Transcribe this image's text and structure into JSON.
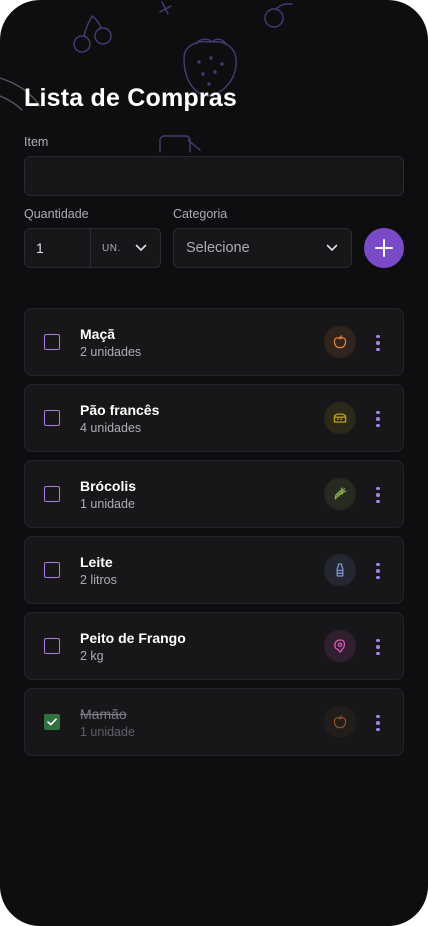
{
  "header": {
    "title": "Lista de Compras"
  },
  "form": {
    "item_label": "Item",
    "item_value": "",
    "quantity_label": "Quantidade",
    "quantity_value": "1",
    "unit_value": "UN.",
    "category_label": "Categoria",
    "category_value": "Selecione"
  },
  "items": [
    {
      "name": "Maçã",
      "quantity": "2 unidades",
      "checked": false,
      "category_icon": "apple-icon",
      "color": "#e07b39"
    },
    {
      "name": "Pão francês",
      "quantity": "4 unidades",
      "checked": false,
      "category_icon": "bread-icon",
      "color": "#bba117"
    },
    {
      "name": "Brócolis",
      "quantity": "1 unidade",
      "checked": false,
      "category_icon": "carrot-icon",
      "color": "#8cad51"
    },
    {
      "name": "Leite",
      "quantity": "2 litros",
      "checked": false,
      "category_icon": "milk-icon",
      "color": "#7b94cb"
    },
    {
      "name": "Peito de Frango",
      "quantity": "2 kg",
      "checked": false,
      "category_icon": "meat-icon",
      "color": "#db5bbf"
    },
    {
      "name": "Mamão",
      "quantity": "1 unidade",
      "checked": true,
      "category_icon": "apple-icon",
      "color": "#e07b39"
    }
  ],
  "colors": {
    "background": "#0e0e10",
    "surface": "#17171a",
    "accent": "#7a4ac9",
    "checkbox": "#a881e6",
    "checked": "#2f723d"
  }
}
